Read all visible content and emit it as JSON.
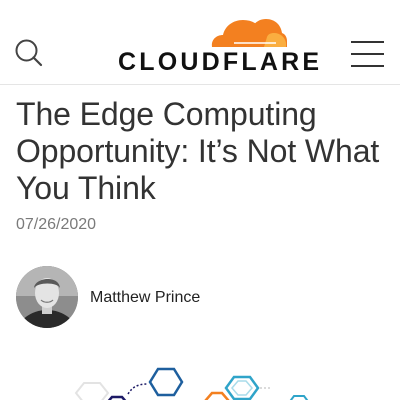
{
  "header": {
    "search_icon": "search-icon",
    "logo_text": "CLOUDFLARE",
    "menu_icon": "hamburger-menu-icon"
  },
  "article": {
    "title": "The Edge Computing Opportunity: It’s Not What You Think",
    "date": "07/26/2020",
    "author": {
      "name": "Matthew Prince",
      "avatar_icon": "author-avatar"
    },
    "hero_image": "hexagon-network-illustration"
  },
  "colors": {
    "brand_orange": "#f38020",
    "brand_light_orange": "#faae40",
    "text_dark": "#333333",
    "date_grey": "#7a7a7a",
    "hex_blue": "#1e5f9e",
    "hex_teal": "#2fa4c9",
    "hex_navy": "#1d1a66"
  }
}
